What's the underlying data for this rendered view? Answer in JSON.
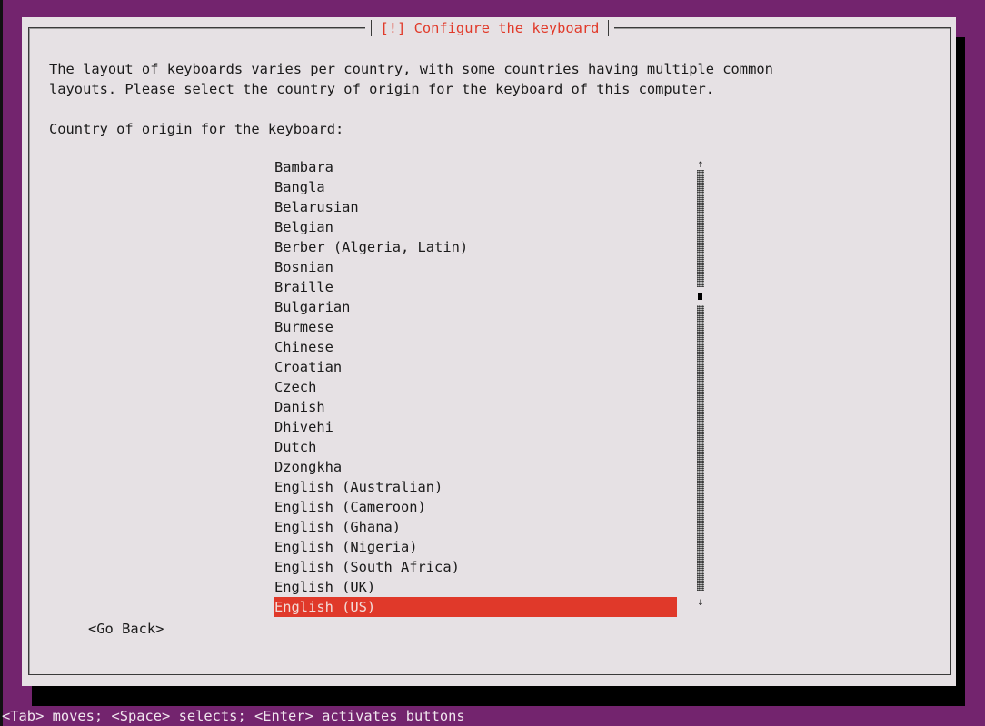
{
  "dialog": {
    "title": "[!] Configure the keyboard",
    "description": "The layout of keyboards varies per country, with some countries having multiple common\nlayouts. Please select the country of origin for the keyboard of this computer.",
    "prompt": "Country of origin for the keyboard:",
    "options": [
      "Bambara",
      "Bangla",
      "Belarusian",
      "Belgian",
      "Berber (Algeria, Latin)",
      "Bosnian",
      "Braille",
      "Bulgarian",
      "Burmese",
      "Chinese",
      "Croatian",
      "Czech",
      "Danish",
      "Dhivehi",
      "Dutch",
      "Dzongkha",
      "English (Australian)",
      "English (Cameroon)",
      "English (Ghana)",
      "English (Nigeria)",
      "English (South Africa)",
      "English (UK)",
      "English (US)"
    ],
    "selected": "English (US)",
    "scroll_up_icon": "↑",
    "scroll_down_icon": "↓",
    "go_back_label": "<Go Back>"
  },
  "status_bar": {
    "text": "<Tab> moves; <Space> selects; <Enter> activates buttons"
  },
  "colors": {
    "background": "#73246e",
    "panel": "#e6e1e4",
    "title_text": "#e13a2a",
    "selection": "#e0392a"
  }
}
